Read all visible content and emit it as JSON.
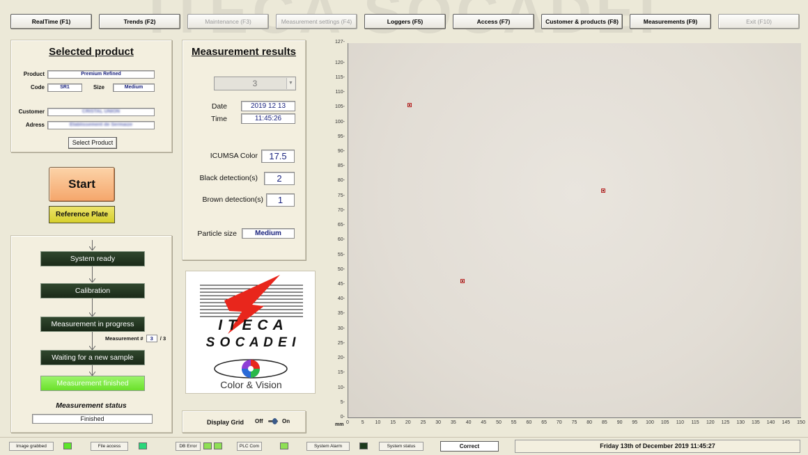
{
  "watermark": "ITECA SOCADEI",
  "toolbar": {
    "buttons": [
      {
        "label": "RealTime (F1)",
        "enabled": true
      },
      {
        "label": "Trends (F2)",
        "enabled": true
      },
      {
        "label": "Maintenance (F3)",
        "enabled": false
      },
      {
        "label": "Measurement settings (F4)",
        "enabled": false
      },
      {
        "label": "Loggers (F5)",
        "enabled": true
      },
      {
        "label": "Access (F7)",
        "enabled": true
      },
      {
        "label": "Customer & products (F8)",
        "enabled": true
      },
      {
        "label": "Measurements (F9)",
        "enabled": true
      },
      {
        "label": "Exit (F10)",
        "enabled": false
      }
    ]
  },
  "product": {
    "title": "Selected product",
    "product_label": "Product",
    "product_value": "Premium Refined",
    "code_label": "Code",
    "code_value": "SR1",
    "size_label": "Size",
    "size_value": "Medium",
    "customer_label": "Customer",
    "customer_value": "CRISTAL UNION",
    "address_label": "Adress",
    "address_value": "Etablissement de Sermaize",
    "select_button": "Select Product"
  },
  "actions": {
    "start": "Start",
    "reference_plate": "Reference Plate"
  },
  "workflow": {
    "steps": [
      {
        "label": "System ready",
        "state": "inactive"
      },
      {
        "label": "Calibration",
        "state": "inactive"
      },
      {
        "label": "Measurement in progress",
        "state": "inactive"
      },
      {
        "label": "Waiting for a new sample",
        "state": "inactive"
      },
      {
        "label": "Measurement finished",
        "state": "active"
      }
    ],
    "counter_label": "Measurement #",
    "counter_value": "3",
    "counter_total": "/ 3",
    "status_title": "Measurement status",
    "status_value": "Finished"
  },
  "results": {
    "title": "Measurement results",
    "selected_measurement": "3",
    "date_label": "Date",
    "date_value": "2019 12 13",
    "time_label": "Time",
    "time_value": "11:45:26",
    "icumsa_label": "ICUMSA Color",
    "icumsa_value": "17.5",
    "black_label": "Black detection(s)",
    "black_value": "2",
    "brown_label": "Brown detection(s)",
    "brown_value": "1",
    "particle_label": "Particle size",
    "particle_value": "Medium"
  },
  "logo": {
    "line1": "I T E C A",
    "line2": "S O C A D E I",
    "tagline": "Color & Vision"
  },
  "grid_toggle": {
    "label": "Display Grid",
    "off": "Off",
    "on": "On"
  },
  "plot": {
    "unit_label": "mm",
    "x_ticks": [
      0,
      5,
      10,
      15,
      20,
      25,
      30,
      35,
      40,
      45,
      50,
      55,
      60,
      65,
      70,
      75,
      80,
      85,
      90,
      95,
      100,
      105,
      110,
      115,
      120,
      125,
      130,
      135,
      140,
      145,
      150
    ],
    "y_ticks": [
      0,
      5,
      10,
      15,
      20,
      25,
      30,
      35,
      40,
      45,
      50,
      55,
      60,
      65,
      70,
      75,
      80,
      85,
      90,
      95,
      100,
      105,
      110,
      115,
      120,
      127
    ],
    "x_range": [
      0,
      150
    ],
    "y_range": [
      0,
      127
    ],
    "detections": [
      {
        "x": 20.5,
        "y": 106
      },
      {
        "x": 84.5,
        "y": 77
      },
      {
        "x": 38,
        "y": 46.5
      }
    ]
  },
  "status": {
    "indicators": [
      {
        "label": "Image grabbed",
        "leds": [
          "#5de52a"
        ]
      },
      {
        "label": "File access",
        "leds": [
          "#2ad77a"
        ]
      },
      {
        "label": "DB Error",
        "leds": [
          "#8fe054",
          "#8fe054"
        ]
      },
      {
        "label": "PLC Com",
        "leds": [
          "#8fe054"
        ]
      },
      {
        "label": "System Alarm",
        "leds": [
          "#1c3a1c"
        ]
      }
    ],
    "system_status_label": "System status",
    "system_status_value": "Correct",
    "datetime": "Friday 13th of December 2019  11:45:27"
  }
}
